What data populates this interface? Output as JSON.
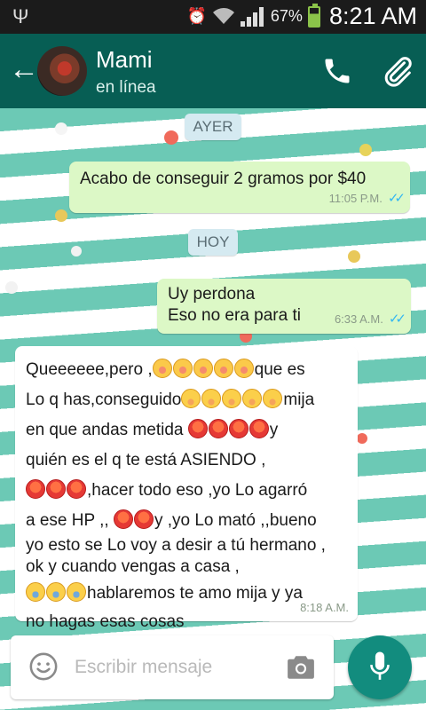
{
  "status_bar": {
    "battery": "67%",
    "time": "8:21 AM",
    "icons": [
      "usb-icon",
      "alarm-icon",
      "wifi-icon",
      "signal-icon",
      "battery-icon"
    ]
  },
  "header": {
    "contact_name": "Mami",
    "contact_status": "en línea",
    "icons": [
      "back-arrow-icon",
      "phone-icon",
      "paperclip-icon"
    ],
    "color": "#075e54"
  },
  "chat": {
    "day_chips": [
      "AYER",
      "HOY"
    ],
    "messages": [
      {
        "direction": "outgoing",
        "lines": [
          "Acabo de conseguir 2 gramos por $40"
        ],
        "time": "11:05 P.M.",
        "ticks": "✓✓"
      },
      {
        "direction": "outgoing",
        "lines": [
          "Uy perdona",
          "Eso no era para ti"
        ],
        "time": "6:33 A.M.",
        "ticks": "✓✓"
      },
      {
        "direction": "incoming",
        "lines": [
          "Queeeeee,pero ,",
          "que es",
          "Lo q has,conseguido",
          "mija",
          "en que andas metida ",
          "y",
          "quién es el q te está ASIENDO ,",
          ",hacer todo eso ,yo Lo agarró",
          "a ese HP ,, ",
          "y ,yo Lo mató ,,bueno",
          "yo esto se Lo voy a desir a tú hermano ,",
          "ok y cuando vengas a casa ,",
          "hablaremos te amo mija y ya",
          "no hagas esas cosas"
        ],
        "time": "8:18 A.M.",
        "emoji": [
          "flushed-face",
          "unamused-face",
          "angry-face",
          "crying-face"
        ]
      }
    ],
    "colors": {
      "outgoing": "#dcf8c6",
      "incoming": "#ffffff",
      "ticks": "#34b7f1"
    }
  },
  "composer": {
    "placeholder": "Escribir mensaje",
    "icons": [
      "smiley-icon",
      "camera-icon",
      "microphone-icon"
    ],
    "accent": "#128c7e"
  }
}
